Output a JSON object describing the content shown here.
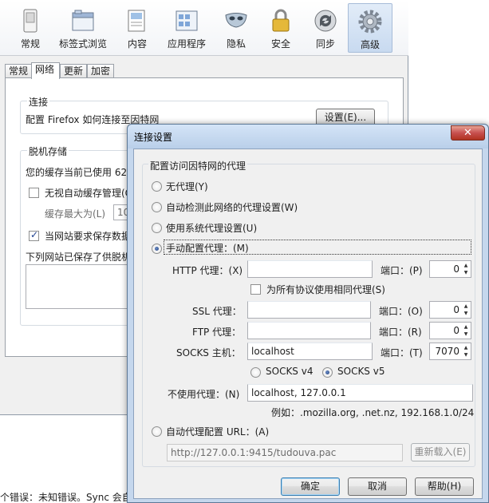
{
  "toolbar": {
    "panes": [
      {
        "label": "常规",
        "icon": "switch-icon"
      },
      {
        "label": "标签式浏览",
        "icon": "tabs-icon"
      },
      {
        "label": "内容",
        "icon": "page-icon"
      },
      {
        "label": "应用程序",
        "icon": "applications-icon"
      },
      {
        "label": "隐私",
        "icon": "mask-icon"
      },
      {
        "label": "安全",
        "icon": "padlock-icon"
      },
      {
        "label": "同步",
        "icon": "sync-icon"
      },
      {
        "label": "高级",
        "icon": "gear-icon"
      }
    ],
    "selected": "高级"
  },
  "advanced_tabs": [
    "常规",
    "网络",
    "更新",
    "加密"
  ],
  "advanced_active_tab": "网络",
  "network": {
    "connection_legend": "连接",
    "connection_text": "配置 Firefox 如何连接至因特网",
    "settings_button": "设置(E)...",
    "offline_legend": "脱机存储",
    "cache_text": "您的缓存当前已使用 62",
    "no_auto_cache": "无视自动缓存管理(O",
    "cache_limit_label": "缓存最大为(L)",
    "cache_limit_value": "10",
    "ask_offline": "当网站要求保存数据",
    "offline_list_label": "下列网站已保存了供脱机"
  },
  "status_text": "个错误：未知错误。Sync 会自",
  "dialog": {
    "title": "连接设置",
    "close_label": "✕",
    "group_label": "配置访问因特网的代理",
    "options": {
      "no_proxy": "无代理(Y)",
      "auto_detect": "自动检测此网络的代理设置(W)",
      "system": "使用系统代理设置(U)",
      "manual": "手动配置代理：(M)",
      "auto_url": "自动代理配置 URL：(A)"
    },
    "selected_option": "manual",
    "http": {
      "label": "HTTP 代理：(X)",
      "host": "",
      "port_label": "端口：(P)",
      "port": "0"
    },
    "same_proxy": "为所有协议使用相同代理(S)",
    "ssl": {
      "label": "SSL 代理：",
      "host": "",
      "port_label": "端口：(O)",
      "port": "0"
    },
    "ftp": {
      "label": "FTP 代理：",
      "host": "",
      "port_label": "端口：(R)",
      "port": "0"
    },
    "socks": {
      "label": "SOCKS 主机：",
      "host": "localhost",
      "port_label": "端口：(T)",
      "port": "7070"
    },
    "socks_v4": "SOCKS v4",
    "socks_v5": "SOCKS v5",
    "socks_version": "v5",
    "no_proxy_for": {
      "label": "不使用代理：(N)",
      "value": "localhost, 127.0.0.1"
    },
    "example": "例如：.mozilla.org, .net.nz, 192.168.1.0/24",
    "pac_url": "http://127.0.0.1:9415/tudouva.pac",
    "reload_button": "重新载入(E)",
    "ok_button": "确定",
    "cancel_button": "取消",
    "help_button": "帮助(H)"
  }
}
